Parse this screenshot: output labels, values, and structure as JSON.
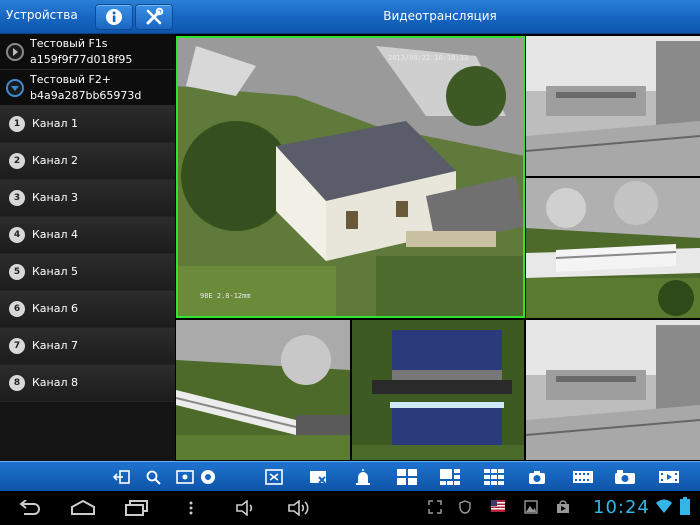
{
  "topbar": {
    "devices_label": "Устройства",
    "title": "Видеотрансляция",
    "info_icon": "info-icon",
    "tools_icon": "tools-icon"
  },
  "devices": [
    {
      "name": "Тестовый F1s",
      "id": "a159f9f77d018f95",
      "state": "collapsed"
    },
    {
      "name": "Тестовый F2+",
      "id": "b4a9a287bb65973d",
      "state": "expanded"
    }
  ],
  "channels": [
    {
      "num": "1",
      "label": "Канал 1"
    },
    {
      "num": "2",
      "label": "Канал 2"
    },
    {
      "num": "3",
      "label": "Канал 3"
    },
    {
      "num": "4",
      "label": "Канал 4"
    },
    {
      "num": "5",
      "label": "Канал 5"
    },
    {
      "num": "6",
      "label": "Канал 6"
    },
    {
      "num": "7",
      "label": "Канал 7"
    },
    {
      "num": "8",
      "label": "Канал 8"
    }
  ],
  "video": {
    "main": {
      "timestamp": "2013/08/22 10:18:33",
      "lens": "98E 2.8-12mm"
    },
    "tile_lens": "98E 2.8-12mm"
  },
  "toolbar_icons": [
    "exit-icon",
    "search-icon",
    "ptz-icon",
    "fullscreen-icon",
    "close-view-icon",
    "alarm-icon",
    "layout-2x2-icon",
    "layout-3x3-icon",
    "layout-4x4-icon",
    "snapshot-icon",
    "record-icon",
    "camera-settings-icon",
    "playback-icon"
  ],
  "statusbar": {
    "time": "10:24"
  },
  "colors": {
    "accent": "#1565c0",
    "active_frame": "#2ee62e",
    "clock": "#33b5e5"
  }
}
